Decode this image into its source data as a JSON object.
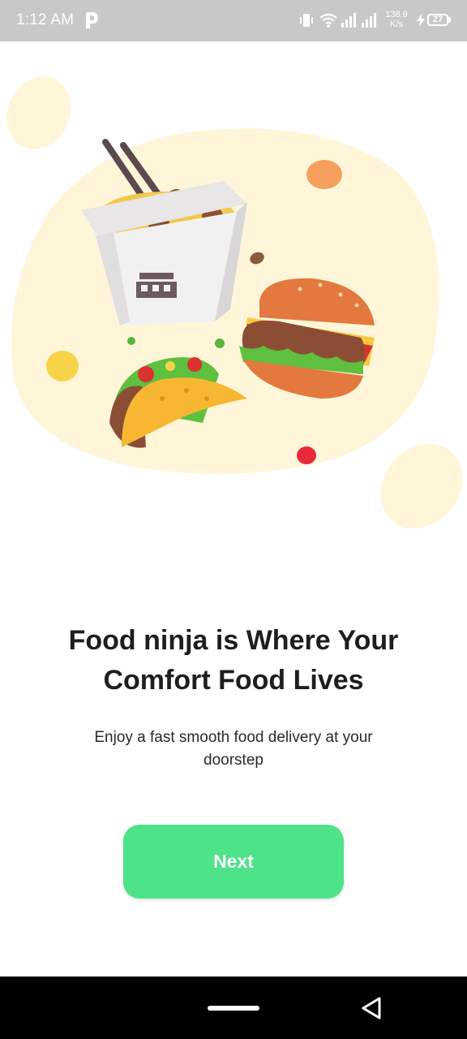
{
  "status_bar": {
    "time": "1:12 AM",
    "net_speed_value": "138.9",
    "net_speed_unit": "K/s",
    "battery_level": "27"
  },
  "onboarding": {
    "illustration": [
      "noodle-box-icon",
      "burger-icon",
      "taco-icon"
    ],
    "title": "Food ninja is Where Your Comfort Food Lives",
    "subtitle": "Enjoy a fast smooth food delivery at your doorstep",
    "next_label": "Next"
  },
  "colors": {
    "accent": "#4ee289",
    "blob": "#fff6d9",
    "status_bar": "#c8c8c8"
  }
}
